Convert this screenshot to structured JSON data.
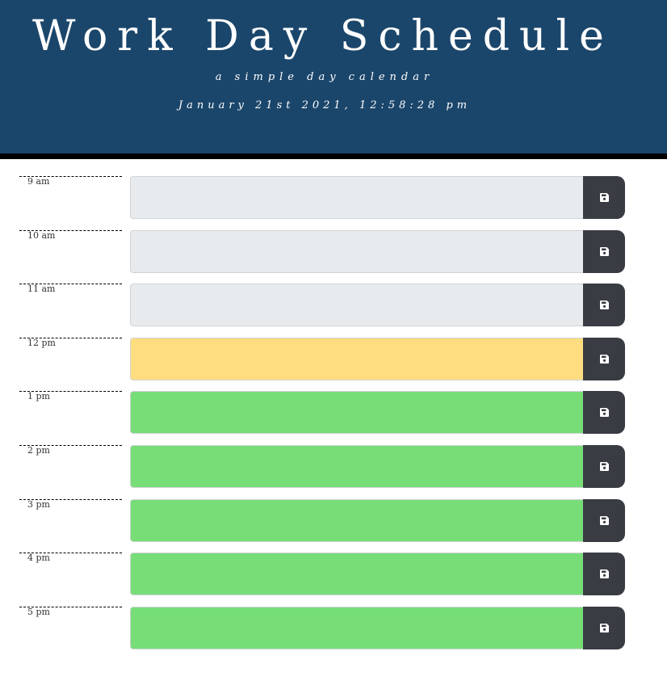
{
  "header": {
    "title": "Work Day Schedule",
    "subtitle": "a simple day calendar",
    "datetime": "January 21st 2021, 12:58:28 pm",
    "background_color": "#1b466b"
  },
  "status_colors": {
    "past": "#e8ebee",
    "present": "#fddd7f",
    "future": "#77dd77"
  },
  "save_icon": "floppy-disk-icon",
  "time_blocks": [
    {
      "hour": "9 am",
      "text": "",
      "status": "past"
    },
    {
      "hour": "10 am",
      "text": "",
      "status": "past"
    },
    {
      "hour": "11 am",
      "text": "",
      "status": "past"
    },
    {
      "hour": "12 pm",
      "text": "",
      "status": "present"
    },
    {
      "hour": "1 pm",
      "text": "",
      "status": "future"
    },
    {
      "hour": "2 pm",
      "text": "",
      "status": "future"
    },
    {
      "hour": "3 pm",
      "text": "",
      "status": "future"
    },
    {
      "hour": "4 pm",
      "text": "",
      "status": "future"
    },
    {
      "hour": "5 pm",
      "text": "",
      "status": "future"
    }
  ]
}
